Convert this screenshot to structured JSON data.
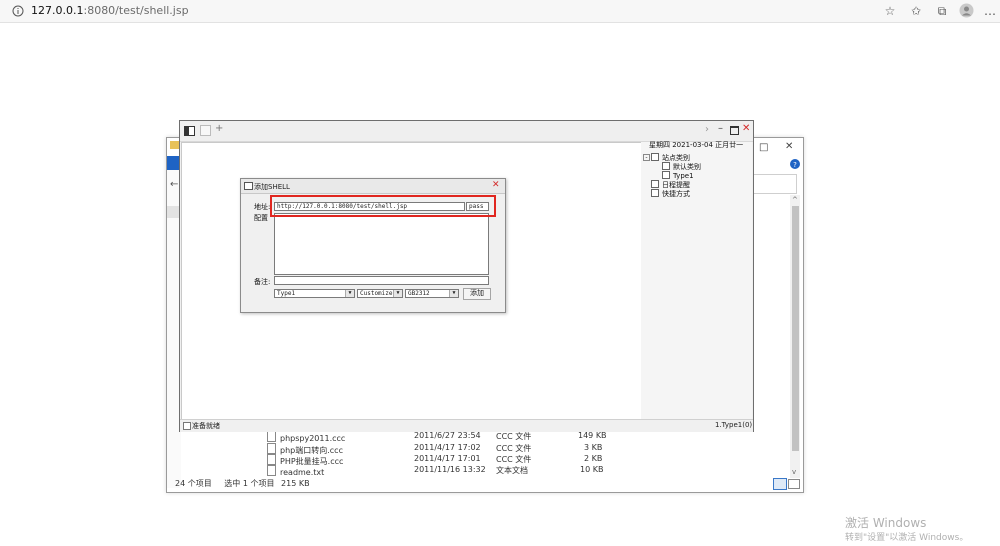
{
  "browser": {
    "url_host": "127.0.0.1",
    "url_rest": ":8080/test/shell.jsp",
    "icons": [
      "info-icon",
      "favorite-add-icon",
      "favorites-icon",
      "collections-icon",
      "profile-icon",
      "more-icon"
    ]
  },
  "explorer": {
    "status": {
      "count": "24 个项目",
      "selected": "选中 1 个项目",
      "size": "215 KB"
    },
    "files": [
      {
        "name": "phpspy2011.ccc",
        "date": "2011/6/27 23:54",
        "type": "CCC 文件",
        "size": "149 KB"
      },
      {
        "name": "php端口转向.ccc",
        "date": "2011/4/17 17:02",
        "type": "CCC 文件",
        "size": "3 KB"
      },
      {
        "name": "PHP批量挂马.ccc",
        "date": "2011/4/17 17:01",
        "type": "CCC 文件",
        "size": "2 KB"
      },
      {
        "name": "readme.txt",
        "date": "2011/11/16 13:32",
        "type": "文本文档",
        "size": "10 KB"
      }
    ]
  },
  "app": {
    "tab_add": "+",
    "date": "星期四  2021-03-04  正月廿一",
    "tree": {
      "site_category": "站点类别",
      "default_category": "默认类别",
      "type1": "Type1",
      "schedule": "日程提醒",
      "shortcuts": "快捷方式"
    },
    "status_left": "准备就绪",
    "status_right": "1.Type1(0)"
  },
  "dialog": {
    "title": "添加SHELL",
    "address_label": "地址:",
    "address_value": "http://127.0.0.1:8080/test/shell.jsp",
    "password_value": "pass",
    "config_label": "配置",
    "note_label": "备注:",
    "type_select": "Type1",
    "script_select": "Customize",
    "encoding_select": "GB2312",
    "add_button": "添加"
  },
  "watermark": {
    "line1": "激活 Windows",
    "line2": "转到\"设置\"以激活 Windows。"
  },
  "colors": {
    "highlight": "#e0261f",
    "close_red": "#d42a2a",
    "explorer_blue": "#1e63c4"
  }
}
